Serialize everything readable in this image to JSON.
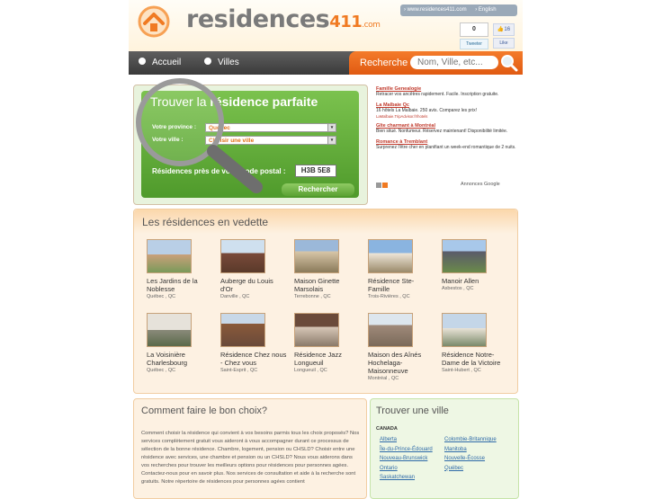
{
  "header": {
    "logo_main": "residences",
    "logo_num": "411",
    "logo_com": ".com",
    "top_link_site": "› www.residences411.com",
    "top_link_lang": "› English",
    "like_count": "0",
    "tweet_label": "Tweeter",
    "fb_count": "16",
    "fb_like_label": "Like"
  },
  "nav": {
    "home": "Accueil",
    "cities": "Villes",
    "search_label": "Recherche",
    "search_placeholder": "Nom, Ville, etc..."
  },
  "finder": {
    "title_light": "Trouver la",
    "title_bold": "résidence parfaite",
    "province_label": "Votre province :",
    "province_value": "Québec",
    "city_label": "Votre ville :",
    "city_value": "Choisir une ville",
    "postal_label": "Résidences près de votre code postal :",
    "postal_value": "H3B 5E8",
    "search_button": "Rechercher"
  },
  "ads": [
    {
      "title": "Famille Genealogie",
      "desc": "Retracer vos ancêtres rapidement. Facile. Inscription gratuite.",
      "url": ""
    },
    {
      "title": "La Malbaie Qc",
      "desc": "16 hôtels La Malbaie. 250 avis. Comparez les prix!",
      "url": "LaMalbaie.TripAdvisor.fr/hotels"
    },
    {
      "title": "Gîte charmant à Montréal",
      "desc": "Bien situé. Nonfumeur. Réservez maintenant! Disponibilité limitée.",
      "url": ""
    },
    {
      "title": "Romance à Tremblant",
      "desc": "Surprenez l'être cher en planifiant un week-end romantique de 2 nuits.",
      "url": ""
    }
  ],
  "ads_footer": "Annonces Google",
  "featured": {
    "title": "Les résidences en vedette",
    "items": [
      {
        "name": "Les Jardins de la Noblesse",
        "loc": "Québec , QC"
      },
      {
        "name": "Auberge du Louis d'Or",
        "loc": "Danville , QC"
      },
      {
        "name": "Maison Ginette Marsolais",
        "loc": "Terrebonne , QC"
      },
      {
        "name": "Résidence Ste-Famille",
        "loc": "Trois-Rivières , QC"
      },
      {
        "name": "Manoir Allen",
        "loc": "Asbestos , QC"
      },
      {
        "name": "La Voisinière Charlesbourg",
        "loc": "Québec , QC"
      },
      {
        "name": "Résidence Chez nous - Chez vous",
        "loc": "Saint-Esprit , QC"
      },
      {
        "name": "Résidence Jazz Longueuil",
        "loc": "Longueuil , QC"
      },
      {
        "name": "Maison des Aînés Hochelaga-Maisonneuve",
        "loc": "Montréal , QC"
      },
      {
        "name": "Résidence Notre-Dame de la Victoire",
        "loc": "Saint-Hubert , QC"
      }
    ]
  },
  "choix": {
    "title": "Comment faire le bon choix?",
    "text": "Comment choisir la résidence qui convient à vos besoins parmis tous les choix proposés? Nos services complètement gratuit vous aideront à vous accompagner durant ce processus de sélection de la bonne résidence. Chambre, logement, pension ou CHSLD? Choisir entre une résidence avec services, une chambre et pension ou un CHSLD? Nous vous aiderons dans vos recherches pour trouver les meilleurs options pour résidences pour personnes agées. Contactez-nous pour en savoir plus. Nos services de consultation et aide à la recherche sont gratuits. Notre répertoire de résidences pour personnes agées contient"
  },
  "ville": {
    "title": "Trouver une ville",
    "country": "CANADA",
    "col1": [
      "Alberta",
      "Île-du-Prince-Édouard",
      "Nouveau-Brunswick",
      "Ontario",
      "Saskatchewan"
    ],
    "col2": [
      "Colombie-Britannique",
      "Manitoba",
      "Nouvelle-Écosse",
      "Québec"
    ]
  },
  "colors": {
    "accent": "#f07a22",
    "nav": "#4a4a4a",
    "finder_green": "#5ba233",
    "link": "#2e6aa8"
  }
}
